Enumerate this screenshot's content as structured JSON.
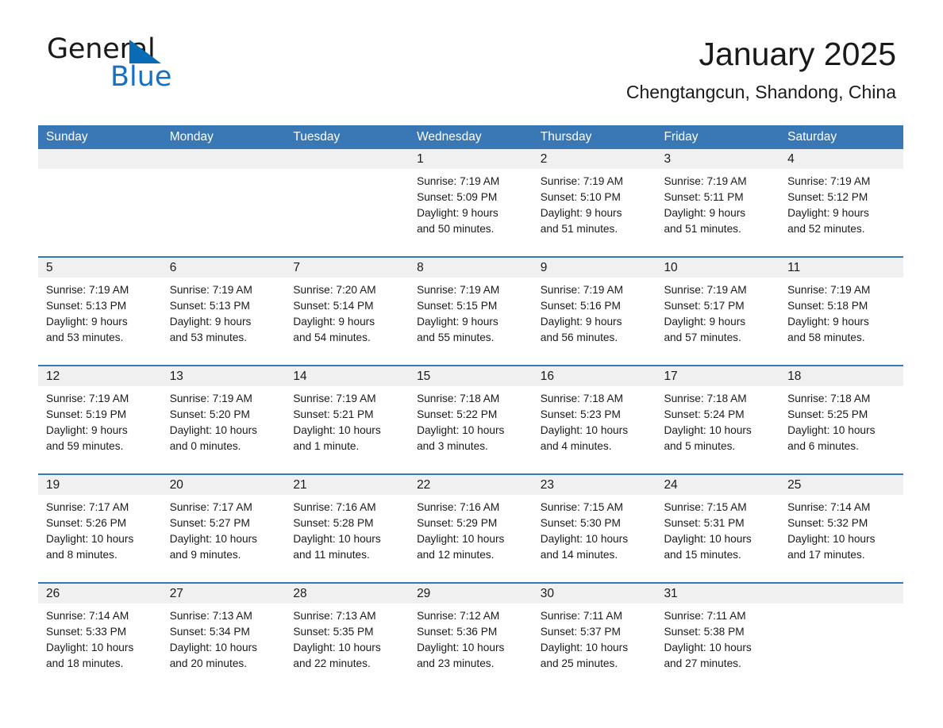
{
  "brand": {
    "name_part1": "General",
    "name_part2": "Blue",
    "triangle_color": "#0a6bb5",
    "blue_text_color": "#1471c4"
  },
  "header": {
    "title": "January 2025",
    "subtitle": "Chengtangcun, Shandong, China",
    "accent_color": "#3a77b5",
    "daynum_band_color": "#f0f0f0"
  },
  "weekday_headers": [
    "Sunday",
    "Monday",
    "Tuesday",
    "Wednesday",
    "Thursday",
    "Friday",
    "Saturday"
  ],
  "weeks": [
    [
      {
        "day": "",
        "sunrise": "",
        "sunset": "",
        "daylight1": "",
        "daylight2": "",
        "empty": true
      },
      {
        "day": "",
        "sunrise": "",
        "sunset": "",
        "daylight1": "",
        "daylight2": "",
        "empty": true
      },
      {
        "day": "",
        "sunrise": "",
        "sunset": "",
        "daylight1": "",
        "daylight2": "",
        "empty": true
      },
      {
        "day": "1",
        "sunrise": "Sunrise: 7:19 AM",
        "sunset": "Sunset: 5:09 PM",
        "daylight1": "Daylight: 9 hours",
        "daylight2": "and 50 minutes.",
        "empty": false
      },
      {
        "day": "2",
        "sunrise": "Sunrise: 7:19 AM",
        "sunset": "Sunset: 5:10 PM",
        "daylight1": "Daylight: 9 hours",
        "daylight2": "and 51 minutes.",
        "empty": false
      },
      {
        "day": "3",
        "sunrise": "Sunrise: 7:19 AM",
        "sunset": "Sunset: 5:11 PM",
        "daylight1": "Daylight: 9 hours",
        "daylight2": "and 51 minutes.",
        "empty": false
      },
      {
        "day": "4",
        "sunrise": "Sunrise: 7:19 AM",
        "sunset": "Sunset: 5:12 PM",
        "daylight1": "Daylight: 9 hours",
        "daylight2": "and 52 minutes.",
        "empty": false
      }
    ],
    [
      {
        "day": "5",
        "sunrise": "Sunrise: 7:19 AM",
        "sunset": "Sunset: 5:13 PM",
        "daylight1": "Daylight: 9 hours",
        "daylight2": "and 53 minutes.",
        "empty": false
      },
      {
        "day": "6",
        "sunrise": "Sunrise: 7:19 AM",
        "sunset": "Sunset: 5:13 PM",
        "daylight1": "Daylight: 9 hours",
        "daylight2": "and 53 minutes.",
        "empty": false
      },
      {
        "day": "7",
        "sunrise": "Sunrise: 7:20 AM",
        "sunset": "Sunset: 5:14 PM",
        "daylight1": "Daylight: 9 hours",
        "daylight2": "and 54 minutes.",
        "empty": false
      },
      {
        "day": "8",
        "sunrise": "Sunrise: 7:19 AM",
        "sunset": "Sunset: 5:15 PM",
        "daylight1": "Daylight: 9 hours",
        "daylight2": "and 55 minutes.",
        "empty": false
      },
      {
        "day": "9",
        "sunrise": "Sunrise: 7:19 AM",
        "sunset": "Sunset: 5:16 PM",
        "daylight1": "Daylight: 9 hours",
        "daylight2": "and 56 minutes.",
        "empty": false
      },
      {
        "day": "10",
        "sunrise": "Sunrise: 7:19 AM",
        "sunset": "Sunset: 5:17 PM",
        "daylight1": "Daylight: 9 hours",
        "daylight2": "and 57 minutes.",
        "empty": false
      },
      {
        "day": "11",
        "sunrise": "Sunrise: 7:19 AM",
        "sunset": "Sunset: 5:18 PM",
        "daylight1": "Daylight: 9 hours",
        "daylight2": "and 58 minutes.",
        "empty": false
      }
    ],
    [
      {
        "day": "12",
        "sunrise": "Sunrise: 7:19 AM",
        "sunset": "Sunset: 5:19 PM",
        "daylight1": "Daylight: 9 hours",
        "daylight2": "and 59 minutes.",
        "empty": false
      },
      {
        "day": "13",
        "sunrise": "Sunrise: 7:19 AM",
        "sunset": "Sunset: 5:20 PM",
        "daylight1": "Daylight: 10 hours",
        "daylight2": "and 0 minutes.",
        "empty": false
      },
      {
        "day": "14",
        "sunrise": "Sunrise: 7:19 AM",
        "sunset": "Sunset: 5:21 PM",
        "daylight1": "Daylight: 10 hours",
        "daylight2": "and 1 minute.",
        "empty": false
      },
      {
        "day": "15",
        "sunrise": "Sunrise: 7:18 AM",
        "sunset": "Sunset: 5:22 PM",
        "daylight1": "Daylight: 10 hours",
        "daylight2": "and 3 minutes.",
        "empty": false
      },
      {
        "day": "16",
        "sunrise": "Sunrise: 7:18 AM",
        "sunset": "Sunset: 5:23 PM",
        "daylight1": "Daylight: 10 hours",
        "daylight2": "and 4 minutes.",
        "empty": false
      },
      {
        "day": "17",
        "sunrise": "Sunrise: 7:18 AM",
        "sunset": "Sunset: 5:24 PM",
        "daylight1": "Daylight: 10 hours",
        "daylight2": "and 5 minutes.",
        "empty": false
      },
      {
        "day": "18",
        "sunrise": "Sunrise: 7:18 AM",
        "sunset": "Sunset: 5:25 PM",
        "daylight1": "Daylight: 10 hours",
        "daylight2": "and 6 minutes.",
        "empty": false
      }
    ],
    [
      {
        "day": "19",
        "sunrise": "Sunrise: 7:17 AM",
        "sunset": "Sunset: 5:26 PM",
        "daylight1": "Daylight: 10 hours",
        "daylight2": "and 8 minutes.",
        "empty": false
      },
      {
        "day": "20",
        "sunrise": "Sunrise: 7:17 AM",
        "sunset": "Sunset: 5:27 PM",
        "daylight1": "Daylight: 10 hours",
        "daylight2": "and 9 minutes.",
        "empty": false
      },
      {
        "day": "21",
        "sunrise": "Sunrise: 7:16 AM",
        "sunset": "Sunset: 5:28 PM",
        "daylight1": "Daylight: 10 hours",
        "daylight2": "and 11 minutes.",
        "empty": false
      },
      {
        "day": "22",
        "sunrise": "Sunrise: 7:16 AM",
        "sunset": "Sunset: 5:29 PM",
        "daylight1": "Daylight: 10 hours",
        "daylight2": "and 12 minutes.",
        "empty": false
      },
      {
        "day": "23",
        "sunrise": "Sunrise: 7:15 AM",
        "sunset": "Sunset: 5:30 PM",
        "daylight1": "Daylight: 10 hours",
        "daylight2": "and 14 minutes.",
        "empty": false
      },
      {
        "day": "24",
        "sunrise": "Sunrise: 7:15 AM",
        "sunset": "Sunset: 5:31 PM",
        "daylight1": "Daylight: 10 hours",
        "daylight2": "and 15 minutes.",
        "empty": false
      },
      {
        "day": "25",
        "sunrise": "Sunrise: 7:14 AM",
        "sunset": "Sunset: 5:32 PM",
        "daylight1": "Daylight: 10 hours",
        "daylight2": "and 17 minutes.",
        "empty": false
      }
    ],
    [
      {
        "day": "26",
        "sunrise": "Sunrise: 7:14 AM",
        "sunset": "Sunset: 5:33 PM",
        "daylight1": "Daylight: 10 hours",
        "daylight2": "and 18 minutes.",
        "empty": false
      },
      {
        "day": "27",
        "sunrise": "Sunrise: 7:13 AM",
        "sunset": "Sunset: 5:34 PM",
        "daylight1": "Daylight: 10 hours",
        "daylight2": "and 20 minutes.",
        "empty": false
      },
      {
        "day": "28",
        "sunrise": "Sunrise: 7:13 AM",
        "sunset": "Sunset: 5:35 PM",
        "daylight1": "Daylight: 10 hours",
        "daylight2": "and 22 minutes.",
        "empty": false
      },
      {
        "day": "29",
        "sunrise": "Sunrise: 7:12 AM",
        "sunset": "Sunset: 5:36 PM",
        "daylight1": "Daylight: 10 hours",
        "daylight2": "and 23 minutes.",
        "empty": false
      },
      {
        "day": "30",
        "sunrise": "Sunrise: 7:11 AM",
        "sunset": "Sunset: 5:37 PM",
        "daylight1": "Daylight: 10 hours",
        "daylight2": "and 25 minutes.",
        "empty": false
      },
      {
        "day": "31",
        "sunrise": "Sunrise: 7:11 AM",
        "sunset": "Sunset: 5:38 PM",
        "daylight1": "Daylight: 10 hours",
        "daylight2": "and 27 minutes.",
        "empty": false
      },
      {
        "day": "",
        "sunrise": "",
        "sunset": "",
        "daylight1": "",
        "daylight2": "",
        "empty": true
      }
    ]
  ]
}
